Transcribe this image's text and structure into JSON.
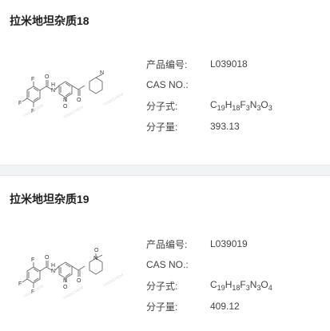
{
  "products": [
    {
      "title": "拉米地坦杂质18",
      "rows": [
        {
          "label": "产品编号:",
          "value": "L039018"
        },
        {
          "label": "CAS NO.:",
          "value": ""
        },
        {
          "label": "分子式:",
          "formula": [
            [
              "C",
              "19"
            ],
            [
              "H",
              "18"
            ],
            [
              "F",
              "3"
            ],
            [
              "N",
              "3"
            ],
            [
              "O",
              "3"
            ]
          ]
        },
        {
          "label": "分子量:",
          "value": "393.13"
        }
      ],
      "structure": {
        "atom_labels": [
          "F",
          "F",
          "F",
          "O",
          "N",
          "H",
          "N",
          "O",
          "O",
          "N"
        ],
        "watermarks": [
          "YRSKCHEM",
          "YRSKCHEM",
          "YRSKCHEM"
        ]
      }
    },
    {
      "title": "拉米地坦杂质19",
      "rows": [
        {
          "label": "产品编号:",
          "value": "L039019"
        },
        {
          "label": "CAS NO.:",
          "value": ""
        },
        {
          "label": "分子式:",
          "formula": [
            [
              "C",
              "19"
            ],
            [
              "H",
              "18"
            ],
            [
              "F",
              "3"
            ],
            [
              "N",
              "3"
            ],
            [
              "O",
              "4"
            ]
          ]
        },
        {
          "label": "分子量:",
          "value": "409.12"
        }
      ],
      "structure": {
        "atom_labels": [
          "F",
          "F",
          "F",
          "O",
          "N",
          "H",
          "N",
          "O",
          "O",
          "O",
          "N"
        ],
        "watermarks": [
          "YRSKCHEM",
          "YRSKCHEM",
          "YRSKCHEM"
        ]
      }
    }
  ]
}
